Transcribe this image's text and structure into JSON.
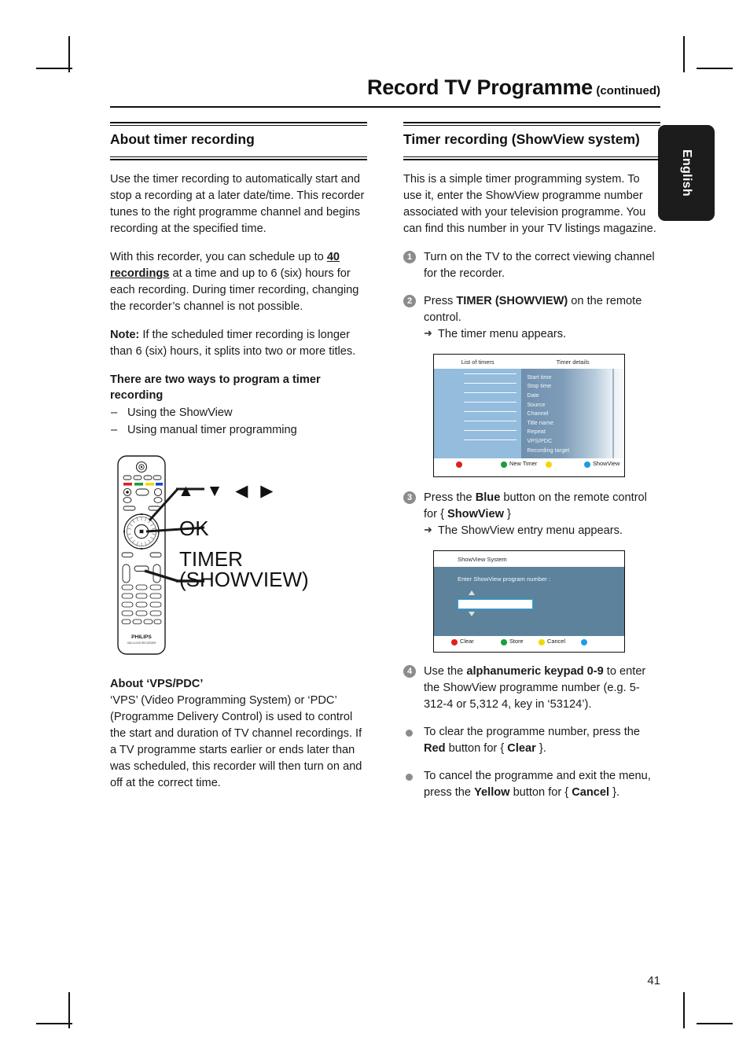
{
  "header": {
    "title": "Record TV Programme",
    "continued": "(continued)"
  },
  "lang_tab": {
    "label": "English"
  },
  "page_number": "41",
  "left_column": {
    "section_title": "About timer recording",
    "paragraph_1": "Use the timer recording to automatically start and stop a recording at a later date/time. This recorder tunes to the right programme channel and begins recording at the specified time.",
    "paragraph_2_part1": "With this recorder, you can schedule up to ",
    "paragraph_2_bold": "40 recordings",
    "paragraph_2_part2": " at a time and up to 6 (six) hours for each recording.  During timer recording, changing the recorder’s channel is not possible.",
    "note_label": "Note:",
    "note_text": " If the scheduled timer recording is longer than 6 (six) hours, it splits into two or more titles.",
    "ways_heading": "There are two ways to program a timer recording",
    "ways_items": [
      "Using the ShowView",
      "Using manual timer programming"
    ],
    "remote_labels": {
      "arrows": "▲ ▼ ◀ ▶",
      "ok": "OK",
      "timer_line1": "TIMER",
      "timer_line2": "(SHOWVIEW)"
    },
    "remote_brand": "PHILIPS",
    "remote_brand_sub": "HDD & DVD RECORDER",
    "vps_heading": "About ‘VPS/PDC’",
    "vps_text": "‘VPS’ (Video Programming System) or ‘PDC’ (Programme Delivery Control) is used to control the start and duration of TV channel recordings. If a TV programme starts earlier or ends later than was scheduled, this recorder will then turn on and off at the correct time."
  },
  "right_column": {
    "section_title": "Timer recording (ShowView system)",
    "intro": "This is a simple timer programming system. To use it, enter the ShowView programme number associated with your television programme. You can find this number in your TV listings magazine.",
    "steps": [
      {
        "num": "1",
        "text": "Turn on the TV to the correct viewing channel for the recorder."
      },
      {
        "num": "2",
        "text_part1": "Press ",
        "text_bold": "TIMER (SHOWVIEW)",
        "text_part2": " on the remote control.",
        "result": "The timer menu appears."
      },
      {
        "num": "3",
        "text_part1": "Press the ",
        "text_bold": "Blue",
        "text_part2": " button on the remote control for { ",
        "text_bold2": "ShowView",
        "text_part3": " }",
        "result": "The ShowView entry menu appears."
      },
      {
        "num": "4",
        "text_part1": "Use the ",
        "text_bold": "alphanumeric keypad 0-9",
        "text_part2": " to enter the ShowView programme number (e.g. 5-312-4 or 5,312 4, key in ‘53124’)."
      }
    ],
    "bullets": [
      {
        "part1": "To clear the programme number, press the ",
        "bold1": "Red",
        "part2": " button for { ",
        "bold2": "Clear",
        "part3": " }."
      },
      {
        "part1": "To cancel the programme and exit the menu, press the ",
        "bold1": "Yellow",
        "part2": " button for { ",
        "bold2": "Cancel",
        "part3": " }."
      }
    ],
    "timer_menu_screen": {
      "header_left": "List of timers",
      "header_right": "Timer details",
      "detail_labels": [
        "Start time",
        "Stop time",
        "Date",
        "Source",
        "Channel",
        "Title name",
        "Repeat",
        "VPS/PDC",
        "Recording target"
      ],
      "buttons": [
        {
          "color": "#e02020",
          "label": ""
        },
        {
          "color": "#1a9e3e",
          "label": "New Timer"
        },
        {
          "color": "#f2d800",
          "label": ""
        },
        {
          "color": "#1a9ee0",
          "label": "ShowView"
        }
      ]
    },
    "showview_screen": {
      "title": "ShowView System",
      "prompt": "Enter ShowView program number :",
      "field_value": "",
      "buttons": [
        {
          "color": "#e02020",
          "label": "Clear"
        },
        {
          "color": "#1a9e3e",
          "label": "Store"
        },
        {
          "color": "#f2d800",
          "label": "Cancel"
        },
        {
          "color": "#1a9ee0",
          "label": ""
        }
      ]
    }
  },
  "colors": {
    "screen_blue": "#94bcdd",
    "showview_bg": "#5d839c",
    "field_border": "#22a8e8",
    "step_badge": "#8c8c8c",
    "tab_bg": "#1c1c1c"
  }
}
